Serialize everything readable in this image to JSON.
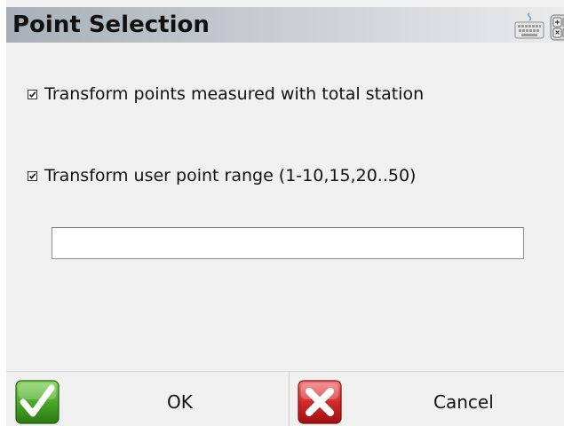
{
  "window": {
    "title": "Point Selection"
  },
  "toolbar": {
    "keyboard_icon": "keyboard-icon",
    "calculator_icon": "calculator-icon"
  },
  "options": [
    {
      "label": "Transform points measured with total station",
      "checked": true
    },
    {
      "label": "Transform user point range (1-10,15,20..50)",
      "checked": true
    }
  ],
  "range_input": {
    "value": "",
    "placeholder": ""
  },
  "buttons": {
    "ok_label": "OK",
    "ok_icon": "checkmark-icon",
    "cancel_label": "Cancel",
    "cancel_icon": "x-mark-icon"
  },
  "colors": {
    "ok_green": "#3f9b1f",
    "cancel_red": "#cf2020"
  }
}
